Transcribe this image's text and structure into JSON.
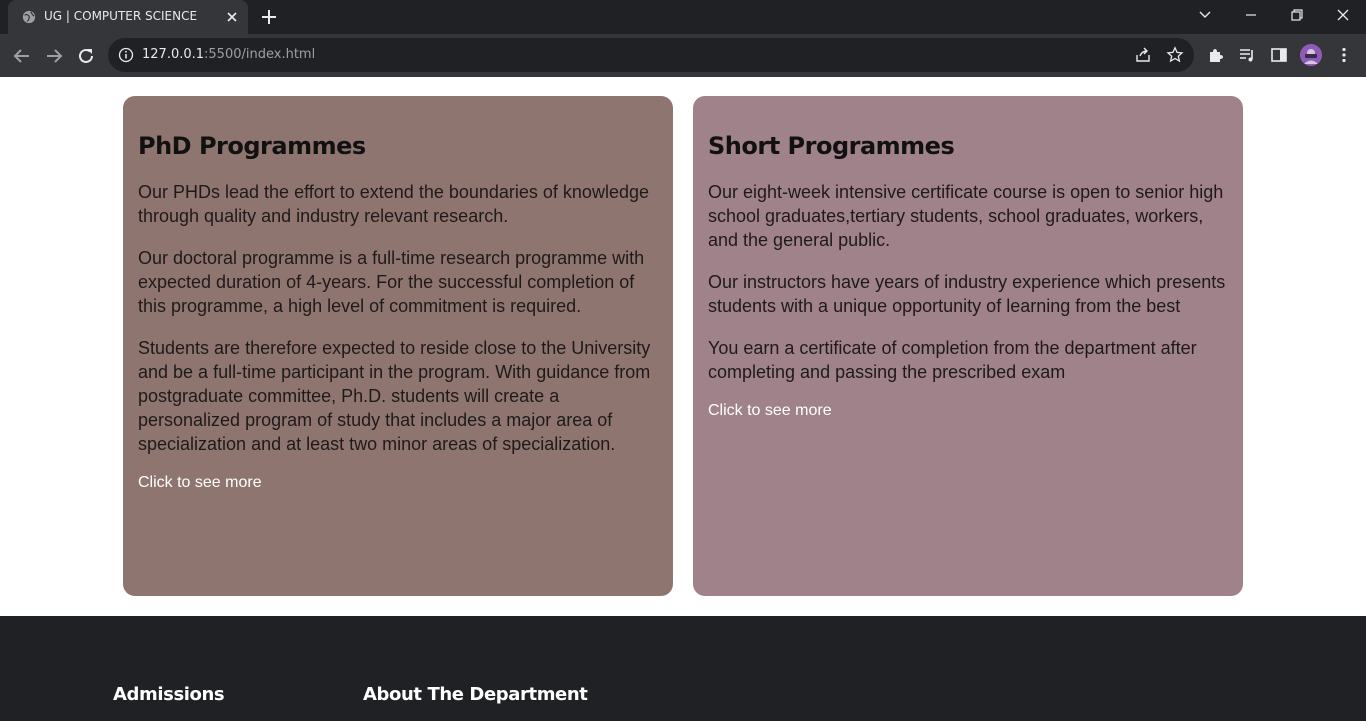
{
  "browser": {
    "tab_title": "UG | COMPUTER SCIENCE",
    "url_host": "127.0.0.1",
    "url_path": ":5500/index.html"
  },
  "cards": [
    {
      "title": "PhD Programmes",
      "paragraphs": [
        "Our PHDs lead the effort to extend the boundaries of knowledge through quality and industry relevant research.",
        "Our doctoral programme is a full-time research programme with expected duration of 4-years. For the successful completion of this programme, a high level of commitment is required.",
        "Students are therefore expected to reside close to the University and be a full-time participant in the program. With guidance from postgraduate committee, Ph.D. students will create a personalized program of study that includes a major area of specialization and at least two minor areas of specialization."
      ],
      "link": "Click to see more"
    },
    {
      "title": "Short Programmes",
      "paragraphs": [
        "Our eight-week intensive certificate course is open to senior high school graduates,tertiary students, school graduates, workers, and the general public.",
        "Our instructors have years of industry experience which presents students with a unique opportunity of learning from the best",
        "You earn a certificate of completion from the department after completing and passing the prescribed exam"
      ],
      "link": "Click to see more"
    }
  ],
  "footer": {
    "admissions": "Admissions",
    "about": "About The Department"
  },
  "colors": {
    "phd_card": "#8f7570",
    "short_card": "#a0828a",
    "footer_bg": "#202124"
  }
}
